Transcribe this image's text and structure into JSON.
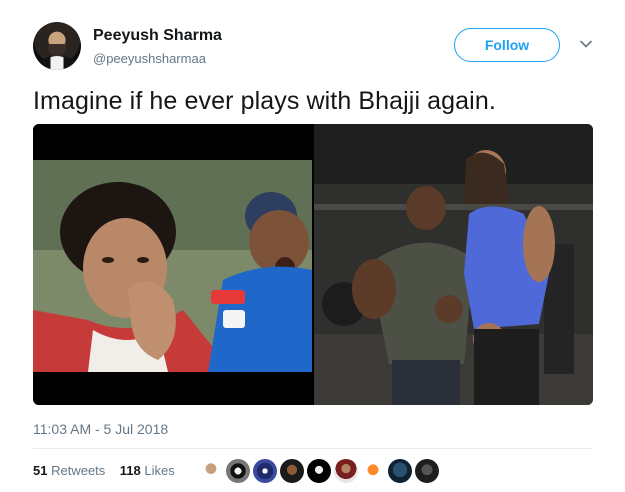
{
  "user": {
    "name": "Peeyush Sharma",
    "handle": "@peeyushsharmaa"
  },
  "actions": {
    "follow_label": "Follow",
    "menu_icon": "chevron-down-icon"
  },
  "tweet": {
    "text": "Imagine if he ever plays with Bhajji again.",
    "timestamp": "11:03 AM - 5 Jul 2018"
  },
  "stats": {
    "retweets_count": "51",
    "retweets_label": "Retweets",
    "likes_count": "118",
    "likes_label": "Likes"
  },
  "colors": {
    "accent": "#1da1f2",
    "text": "#14171a",
    "muted": "#657786"
  },
  "likers": [
    {
      "icon": "avatar-1"
    },
    {
      "icon": "avatar-2"
    },
    {
      "icon": "avatar-3"
    },
    {
      "icon": "avatar-4"
    },
    {
      "icon": "avatar-5"
    },
    {
      "icon": "avatar-6"
    },
    {
      "icon": "avatar-7"
    },
    {
      "icon": "avatar-8"
    },
    {
      "icon": "avatar-9"
    }
  ]
}
